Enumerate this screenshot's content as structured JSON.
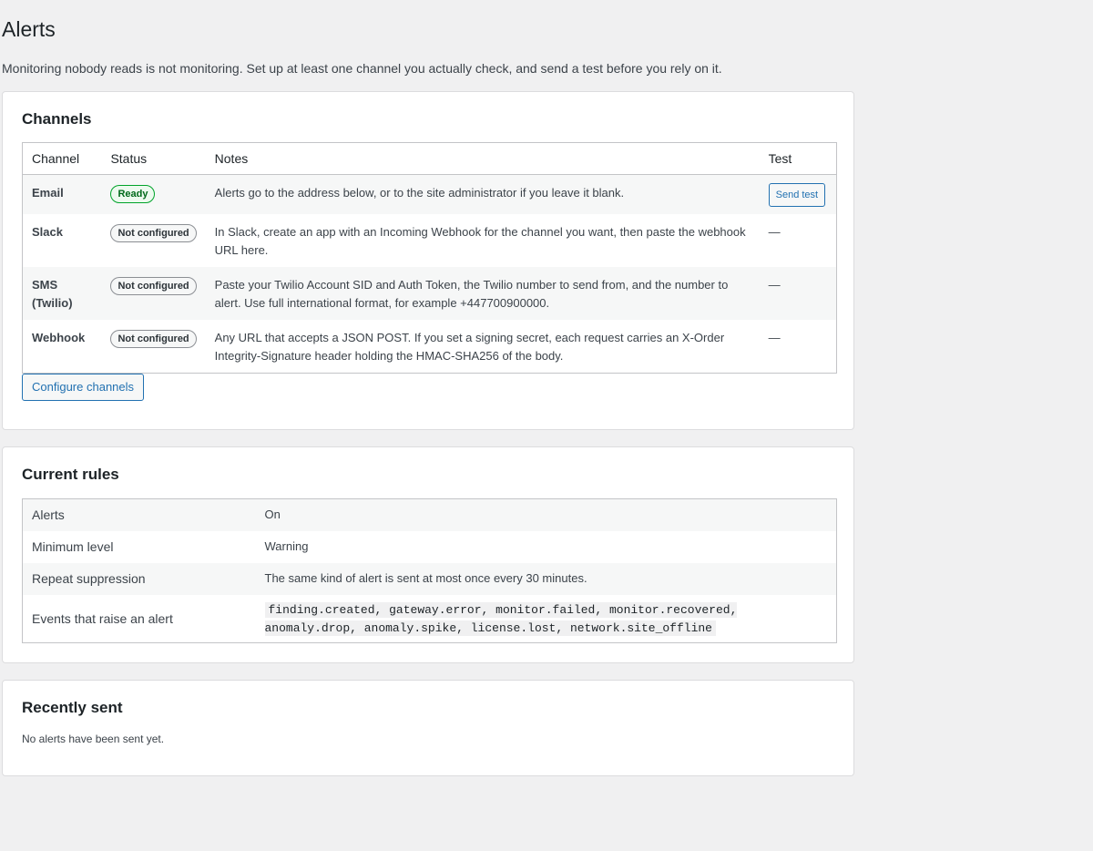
{
  "page": {
    "title": "Alerts",
    "intro": "Monitoring nobody reads is not monitoring. Set up at least one channel you actually check, and send a test before you rely on it."
  },
  "channels": {
    "heading": "Channels",
    "columns": {
      "channel": "Channel",
      "status": "Status",
      "notes": "Notes",
      "test": "Test"
    },
    "rows": [
      {
        "name": "Email",
        "status": "Ready",
        "notes": "Alerts go to the address below, or to the site administrator if you leave it blank.",
        "test": "Send test"
      },
      {
        "name": "Slack",
        "status": "Not configured",
        "notes": "In Slack, create an app with an Incoming Webhook for the channel you want, then paste the webhook URL here.",
        "test": "—"
      },
      {
        "name": "SMS (Twilio)",
        "status": "Not configured",
        "notes": "Paste your Twilio Account SID and Auth Token, the Twilio number to send from, and the number to alert. Use full international format, for example +447700900000.",
        "test": "—"
      },
      {
        "name": "Webhook",
        "status": "Not configured",
        "notes": "Any URL that accepts a JSON POST. If you set a signing secret, each request carries an X-Order Integrity-Signature header holding the HMAC-SHA256 of the body.",
        "test": "—"
      }
    ],
    "configure_button": "Configure channels"
  },
  "rules": {
    "heading": "Current rules",
    "rows": [
      {
        "key": "Alerts",
        "value": "On"
      },
      {
        "key": "Minimum level",
        "value": "Warning"
      },
      {
        "key": "Repeat suppression",
        "value": "The same kind of alert is sent at most once every 30 minutes."
      },
      {
        "key": "Events that raise an alert",
        "value": "finding.created, gateway.error, monitor.failed, monitor.recovered, anomaly.drop, anomaly.spike, license.lost, network.site_offline"
      }
    ]
  },
  "recent": {
    "heading": "Recently sent",
    "empty_text": "No alerts have been sent yet."
  },
  "colors": {
    "accent": "#2271b1",
    "ready": "#00a32a",
    "background": "#f0f0f1"
  }
}
